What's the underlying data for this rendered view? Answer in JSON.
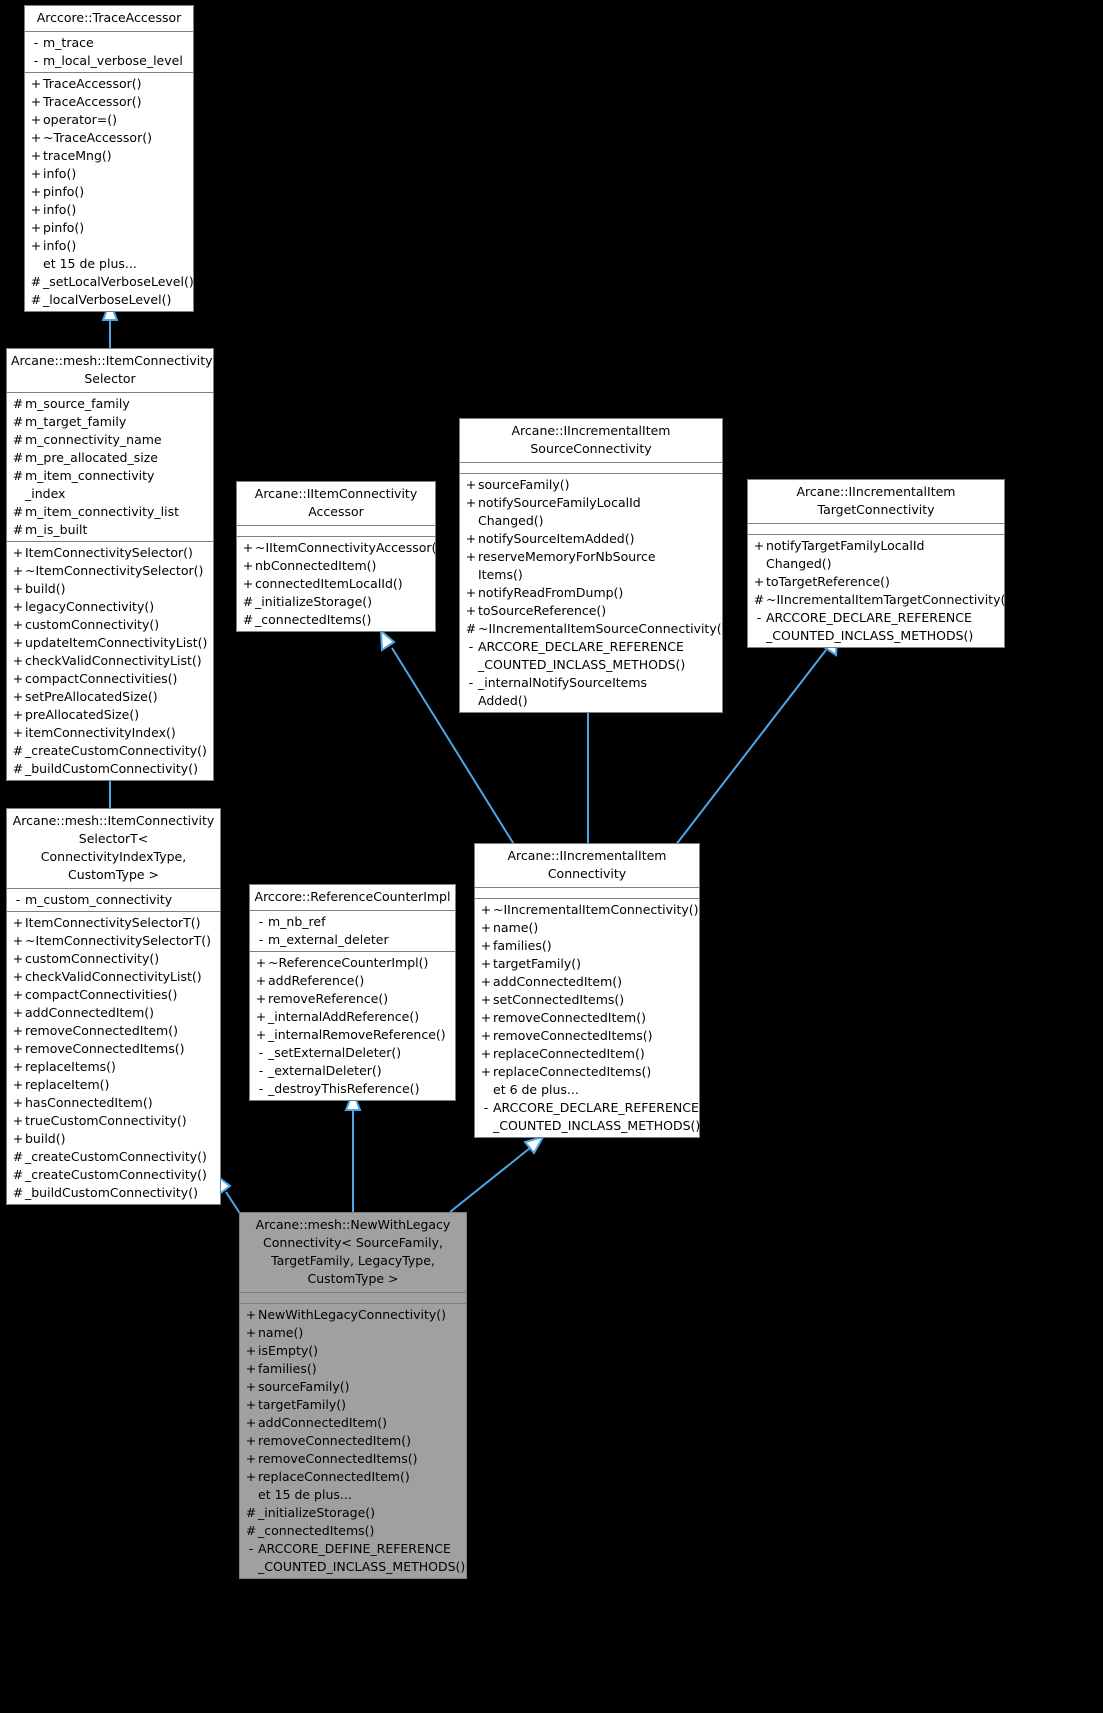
{
  "diagram": {
    "kind": "uml-class-inheritance-diagram",
    "background": "#000000",
    "edge_color": "#4da6e8",
    "highlight_color": "#a0a0a0"
  },
  "classes": [
    {
      "id": "trace-accessor",
      "title": "Arccore::TraceAccessor",
      "highlight": false,
      "attributes": [
        {
          "vis": "-",
          "name": "m_trace"
        },
        {
          "vis": "-",
          "name": "m_local_verbose_level"
        }
      ],
      "methods": [
        {
          "vis": "+",
          "name": "TraceAccessor()"
        },
        {
          "vis": "+",
          "name": "TraceAccessor()"
        },
        {
          "vis": "+",
          "name": "operator=()"
        },
        {
          "vis": "+",
          "name": "~TraceAccessor()"
        },
        {
          "vis": "+",
          "name": "traceMng()"
        },
        {
          "vis": "+",
          "name": "info()"
        },
        {
          "vis": "+",
          "name": "pinfo()"
        },
        {
          "vis": "+",
          "name": "info()"
        },
        {
          "vis": "+",
          "name": "pinfo()"
        },
        {
          "vis": "+",
          "name": "info()"
        },
        {
          "vis": "",
          "name": "et 15 de plus..."
        },
        {
          "vis": "#",
          "name": "_setLocalVerboseLevel()"
        },
        {
          "vis": "#",
          "name": "_localVerboseLevel()"
        }
      ]
    },
    {
      "id": "item-connectivity-selector",
      "title": "Arcane::mesh::ItemConnectivity\nSelector",
      "highlight": false,
      "attributes": [
        {
          "vis": "#",
          "name": "m_source_family"
        },
        {
          "vis": "#",
          "name": "m_target_family"
        },
        {
          "vis": "#",
          "name": "m_connectivity_name"
        },
        {
          "vis": "#",
          "name": "m_pre_allocated_size"
        },
        {
          "vis": "#",
          "name": "m_item_connectivity\n_index"
        },
        {
          "vis": "#",
          "name": "m_item_connectivity_list"
        },
        {
          "vis": "#",
          "name": "m_is_built"
        }
      ],
      "methods": [
        {
          "vis": "+",
          "name": "ItemConnectivitySelector()"
        },
        {
          "vis": "+",
          "name": "~ItemConnectivitySelector()"
        },
        {
          "vis": "+",
          "name": "build()"
        },
        {
          "vis": "+",
          "name": "legacyConnectivity()"
        },
        {
          "vis": "+",
          "name": "customConnectivity()"
        },
        {
          "vis": "+",
          "name": "updateItemConnectivityList()"
        },
        {
          "vis": "+",
          "name": "checkValidConnectivityList()"
        },
        {
          "vis": "+",
          "name": "compactConnectivities()"
        },
        {
          "vis": "+",
          "name": "setPreAllocatedSize()"
        },
        {
          "vis": "+",
          "name": "preAllocatedSize()"
        },
        {
          "vis": "+",
          "name": "itemConnectivityIndex()"
        },
        {
          "vis": "#",
          "name": "_createCustomConnectivity()"
        },
        {
          "vis": "#",
          "name": "_buildCustomConnectivity()"
        }
      ]
    },
    {
      "id": "item-connectivity-selector-t",
      "title": "Arcane::mesh::ItemConnectivity\nSelectorT< ConnectivityIndexType,\nCustomType >",
      "highlight": false,
      "attributes": [
        {
          "vis": "-",
          "name": "m_custom_connectivity"
        }
      ],
      "methods": [
        {
          "vis": "+",
          "name": "ItemConnectivitySelectorT()"
        },
        {
          "vis": "+",
          "name": "~ItemConnectivitySelectorT()"
        },
        {
          "vis": "+",
          "name": "customConnectivity()"
        },
        {
          "vis": "+",
          "name": "checkValidConnectivityList()"
        },
        {
          "vis": "+",
          "name": "compactConnectivities()"
        },
        {
          "vis": "+",
          "name": "addConnectedItem()"
        },
        {
          "vis": "+",
          "name": "removeConnectedItem()"
        },
        {
          "vis": "+",
          "name": "removeConnectedItems()"
        },
        {
          "vis": "+",
          "name": "replaceItems()"
        },
        {
          "vis": "+",
          "name": "replaceItem()"
        },
        {
          "vis": "+",
          "name": "hasConnectedItem()"
        },
        {
          "vis": "+",
          "name": "trueCustomConnectivity()"
        },
        {
          "vis": "+",
          "name": "build()"
        },
        {
          "vis": "#",
          "name": "_createCustomConnectivity()"
        },
        {
          "vis": "#",
          "name": "_createCustomConnectivity()"
        },
        {
          "vis": "#",
          "name": "_buildCustomConnectivity()"
        }
      ]
    },
    {
      "id": "iitem-connectivity-accessor",
      "title": "Arcane::IItemConnectivity\nAccessor",
      "highlight": false,
      "attributes": [],
      "methods": [
        {
          "vis": "+",
          "name": "~IItemConnectivityAccessor()"
        },
        {
          "vis": "+",
          "name": "nbConnectedItem()"
        },
        {
          "vis": "+",
          "name": "connectedItemLocalId()"
        },
        {
          "vis": "#",
          "name": "_initializeStorage()"
        },
        {
          "vis": "#",
          "name": "_connectedItems()"
        }
      ]
    },
    {
      "id": "iincremental-item-source-connectivity",
      "title": "Arcane::IIncrementalItem\nSourceConnectivity",
      "highlight": false,
      "attributes": [],
      "methods": [
        {
          "vis": "+",
          "name": "sourceFamily()"
        },
        {
          "vis": "+",
          "name": "notifySourceFamilyLocalId\nChanged()"
        },
        {
          "vis": "+",
          "name": "notifySourceItemAdded()"
        },
        {
          "vis": "+",
          "name": "reserveMemoryForNbSource\nItems()"
        },
        {
          "vis": "+",
          "name": "notifyReadFromDump()"
        },
        {
          "vis": "+",
          "name": "toSourceReference()"
        },
        {
          "vis": "#",
          "name": "~IIncrementalItemSourceConnectivity()"
        },
        {
          "vis": "-",
          "name": "ARCCORE_DECLARE_REFERENCE\n_COUNTED_INCLASS_METHODS()"
        },
        {
          "vis": "-",
          "name": "_internalNotifySourceItems\nAdded()"
        }
      ]
    },
    {
      "id": "iincremental-item-target-connectivity",
      "title": "Arcane::IIncrementalItem\nTargetConnectivity",
      "highlight": false,
      "attributes": [],
      "methods": [
        {
          "vis": "+",
          "name": "notifyTargetFamilyLocalId\nChanged()"
        },
        {
          "vis": "+",
          "name": "toTargetReference()"
        },
        {
          "vis": "#",
          "name": "~IIncrementalItemTargetConnectivity()"
        },
        {
          "vis": "-",
          "name": "ARCCORE_DECLARE_REFERENCE\n_COUNTED_INCLASS_METHODS()"
        }
      ]
    },
    {
      "id": "reference-counter-impl",
      "title": "Arccore::ReferenceCounterImpl",
      "highlight": false,
      "attributes": [
        {
          "vis": "-",
          "name": "m_nb_ref"
        },
        {
          "vis": "-",
          "name": "m_external_deleter"
        }
      ],
      "methods": [
        {
          "vis": "+",
          "name": "~ReferenceCounterImpl()"
        },
        {
          "vis": "+",
          "name": "addReference()"
        },
        {
          "vis": "+",
          "name": "removeReference()"
        },
        {
          "vis": "+",
          "name": "_internalAddReference()"
        },
        {
          "vis": "+",
          "name": "_internalRemoveReference()"
        },
        {
          "vis": "-",
          "name": "_setExternalDeleter()"
        },
        {
          "vis": "-",
          "name": "_externalDeleter()"
        },
        {
          "vis": "-",
          "name": "_destroyThisReference()"
        }
      ]
    },
    {
      "id": "iincremental-item-connectivity",
      "title": "Arcane::IIncrementalItem\nConnectivity",
      "highlight": false,
      "attributes": [],
      "methods": [
        {
          "vis": "+",
          "name": "~IIncrementalItemConnectivity()"
        },
        {
          "vis": "+",
          "name": "name()"
        },
        {
          "vis": "+",
          "name": "families()"
        },
        {
          "vis": "+",
          "name": "targetFamily()"
        },
        {
          "vis": "+",
          "name": "addConnectedItem()"
        },
        {
          "vis": "+",
          "name": "setConnectedItems()"
        },
        {
          "vis": "+",
          "name": "removeConnectedItem()"
        },
        {
          "vis": "+",
          "name": "removeConnectedItems()"
        },
        {
          "vis": "+",
          "name": "replaceConnectedItem()"
        },
        {
          "vis": "+",
          "name": "replaceConnectedItems()"
        },
        {
          "vis": "",
          "name": "et 6 de plus..."
        },
        {
          "vis": "-",
          "name": "ARCCORE_DECLARE_REFERENCE\n_COUNTED_INCLASS_METHODS()"
        }
      ]
    },
    {
      "id": "new-with-legacy-connectivity",
      "title": "Arcane::mesh::NewWithLegacy\nConnectivity< SourceFamily,\nTargetFamily, LegacyType,\nCustomType >",
      "highlight": true,
      "attributes": [],
      "methods": [
        {
          "vis": "+",
          "name": "NewWithLegacyConnectivity()"
        },
        {
          "vis": "+",
          "name": "name()"
        },
        {
          "vis": "+",
          "name": "isEmpty()"
        },
        {
          "vis": "+",
          "name": "families()"
        },
        {
          "vis": "+",
          "name": "sourceFamily()"
        },
        {
          "vis": "+",
          "name": "targetFamily()"
        },
        {
          "vis": "+",
          "name": "addConnectedItem()"
        },
        {
          "vis": "+",
          "name": "removeConnectedItem()"
        },
        {
          "vis": "+",
          "name": "removeConnectedItems()"
        },
        {
          "vis": "+",
          "name": "replaceConnectedItem()"
        },
        {
          "vis": "",
          "name": "et 15 de plus..."
        },
        {
          "vis": "#",
          "name": "_initializeStorage()"
        },
        {
          "vis": "#",
          "name": "_connectedItems()"
        },
        {
          "vis": "-",
          "name": "ARCCORE_DEFINE_REFERENCE\n_COUNTED_INCLASS_METHODS()"
        }
      ]
    }
  ]
}
